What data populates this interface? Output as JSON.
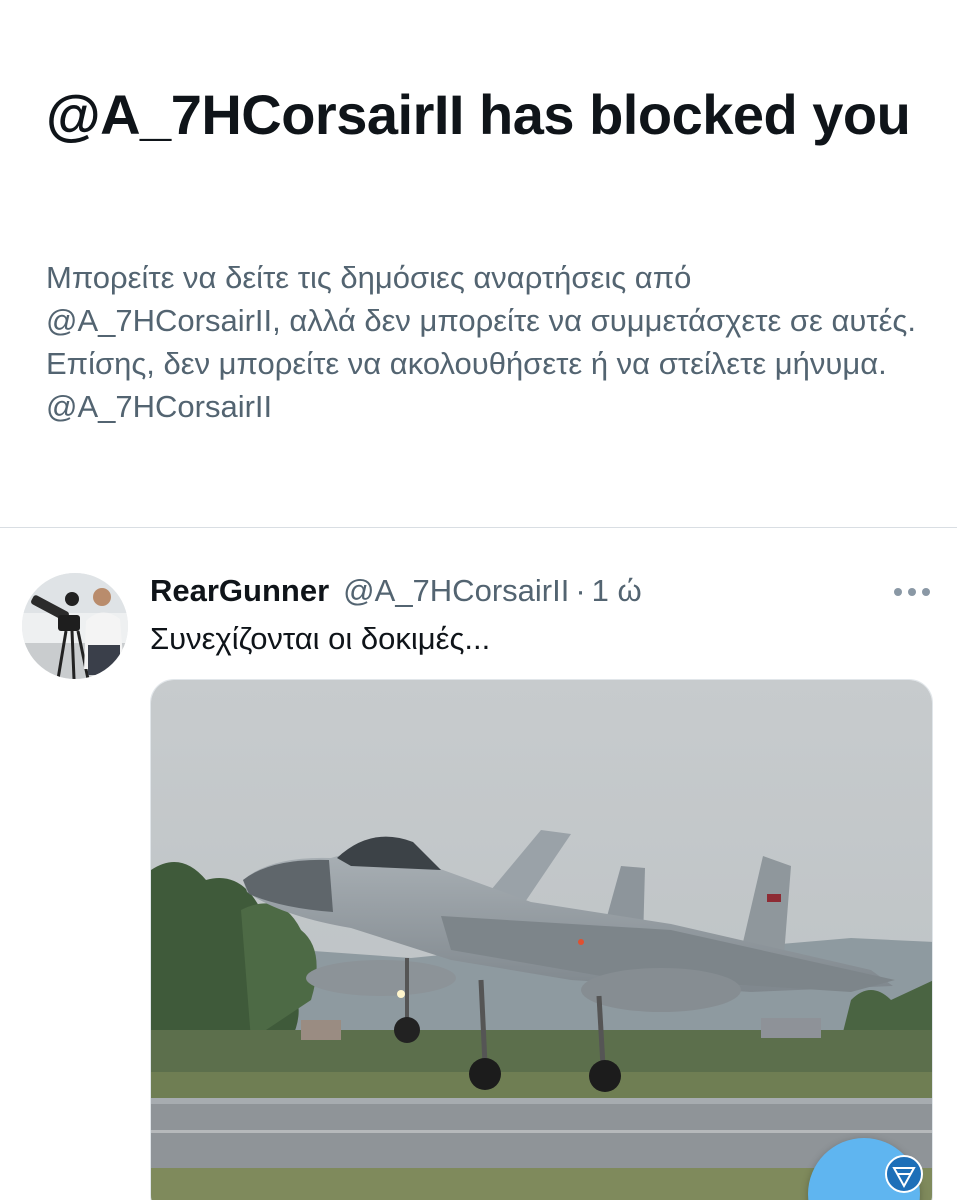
{
  "blocked_notice": {
    "title": "@A_7HCorsairII has blocked you",
    "description": "Μπορείτε να δείτε τις δημόσιες αναρτήσεις από @A_7HCorsairII, αλλά δεν μπορείτε να συμμετάσχετε σε αυτές. Επίσης, δεν μπορείτε να ακολουθήσετε ή να στείλετε μήνυμα. @A_7HCorsairII"
  },
  "tweet": {
    "display_name": "RearGunner",
    "handle": "@A_7HCorsairII",
    "separator": "·",
    "time": "1 ώ",
    "text": "Συνεχίζονται οι δοκιμές...",
    "more_icon": "more-horizontal-icon",
    "media_subject": "fighter jet taking off from runway"
  },
  "colors": {
    "text_primary": "#0f1419",
    "text_secondary": "#536471",
    "divider": "#d9dee3",
    "fab": "#5fb5f0"
  }
}
